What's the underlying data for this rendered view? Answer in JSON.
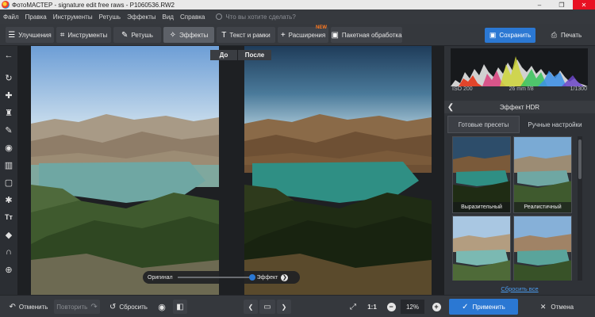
{
  "window": {
    "title": "ФотоМАСТЕР - signature edit free raws - P1060536.RW2",
    "minimize": "–",
    "maximize": "❐",
    "close": "✕"
  },
  "menu": {
    "items": [
      "Файл",
      "Правка",
      "Инструменты",
      "Ретушь",
      "Эффекты",
      "Вид",
      "Справка"
    ],
    "search_placeholder": "Что вы хотите сделать?"
  },
  "toolbar": {
    "tabs": [
      {
        "label": "Улучшения",
        "icon": "sliders-icon",
        "glyph": "☰"
      },
      {
        "label": "Инструменты",
        "icon": "crop-icon",
        "glyph": "⌗"
      },
      {
        "label": "Ретушь",
        "icon": "brush-icon",
        "glyph": "✎"
      },
      {
        "label": "Эффекты",
        "icon": "magic-wand-icon",
        "glyph": "✧",
        "active": true
      },
      {
        "label": "Текст и рамки",
        "icon": "text-icon",
        "glyph": "T"
      },
      {
        "label": "Расширения",
        "icon": "plus-icon",
        "glyph": "+",
        "badge": "NEW"
      },
      {
        "label": "Пакетная обработка",
        "icon": "batch-icon",
        "glyph": "▣"
      }
    ],
    "save_label": "Сохранить",
    "print_label": "Печать"
  },
  "rail": {
    "tools": [
      {
        "icon": "back-arrow-icon",
        "glyph": "←"
      },
      {
        "icon": "rotate-icon",
        "glyph": "↻"
      },
      {
        "icon": "patch-icon",
        "glyph": "✚"
      },
      {
        "icon": "stamp-icon",
        "glyph": "♜"
      },
      {
        "icon": "brush-icon",
        "glyph": "✎"
      },
      {
        "icon": "radial-filter-icon",
        "glyph": "◉"
      },
      {
        "icon": "gradient-icon",
        "glyph": "▥"
      },
      {
        "icon": "vignette-icon",
        "glyph": "▢"
      },
      {
        "icon": "settings-icon",
        "glyph": "✱"
      },
      {
        "icon": "text-tool-icon",
        "glyph": "Tт"
      },
      {
        "icon": "fill-icon",
        "glyph": "◆"
      },
      {
        "icon": "magnet-icon",
        "glyph": "∩"
      },
      {
        "icon": "globe-icon",
        "glyph": "⊕"
      }
    ]
  },
  "canvas": {
    "before_label": "До",
    "after_label": "После",
    "slider_left_label": "Оригинал",
    "slider_right_label": "Эффект",
    "slider_value": 1.0,
    "slider_arrow": "❯"
  },
  "panel": {
    "exif": {
      "iso": "ISO 200",
      "lens": "26 mm f/8",
      "shutter": "1/1300"
    },
    "section_title": "Эффект HDR",
    "back_glyph": "❮",
    "tabs": [
      {
        "label": "Готовые пресеты",
        "active": true
      },
      {
        "label": "Ручные настройки",
        "active": false
      }
    ],
    "presets": [
      {
        "label": "Выразительный"
      },
      {
        "label": "Реалистичный"
      },
      {
        "label": ""
      },
      {
        "label": ""
      }
    ],
    "reset_all": "Сбросить все"
  },
  "bottombar": {
    "undo_label": "Отменить",
    "redo_label": "Повторить",
    "reset_label": "Сбросить",
    "zoom_fit_glyph": "⤢",
    "zoom_1to1": "1:1",
    "zoom_value": "12%",
    "zoom_out_glyph": "−",
    "zoom_in_glyph": "+",
    "prev_glyph": "❮",
    "next_glyph": "❯",
    "apply_label": "Применить",
    "cancel_label": "Отмена"
  }
}
